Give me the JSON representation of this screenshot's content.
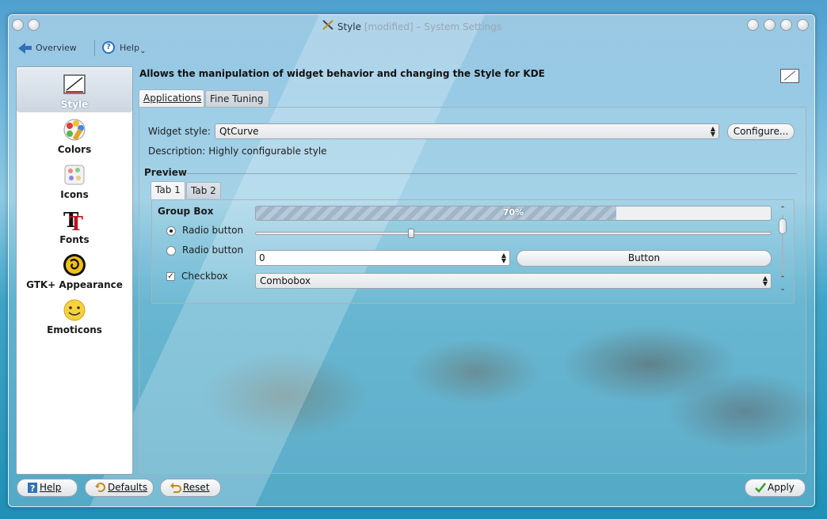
{
  "window": {
    "title_main": "Style",
    "title_modified": "[modified]",
    "title_sep": "–",
    "title_app": "System Settings"
  },
  "navbar": {
    "overview": "Overview",
    "help": "Help",
    "help_arrow": "⌄"
  },
  "sidebar": {
    "items": [
      {
        "label": "Style",
        "icon": "style-icon",
        "selected": true
      },
      {
        "label": "Colors",
        "icon": "colors-icon"
      },
      {
        "label": "Icons",
        "icon": "icons-icon"
      },
      {
        "label": "Fonts",
        "icon": "fonts-icon"
      },
      {
        "label": "GTK+ Appearance",
        "icon": "gtk-icon"
      },
      {
        "label": "Emoticons",
        "icon": "emoticons-icon"
      }
    ]
  },
  "main": {
    "description": "Allows the manipulation of widget behavior and changing the Style for KDE",
    "tabs": [
      {
        "label": "Applications",
        "active": true
      },
      {
        "label": "Fine Tuning",
        "active": false
      }
    ],
    "widget_style_label": "Widget style:",
    "widget_style_value": "QtCurve",
    "configure_label": "Configure...",
    "description_text": "Description: Highly configurable style",
    "preview_title": "Preview",
    "preview": {
      "tabs": [
        "Tab 1",
        "Tab 2"
      ],
      "group_box": "Group Box",
      "progress_percent": 70,
      "progress_text": "70%",
      "slider_fraction": 0.3,
      "radio1": "Radio button",
      "radio2": "Radio button",
      "spin_value": "0",
      "button_label": "Button",
      "checkbox_label": "Checkbox",
      "checkbox_checked": true,
      "combobox_value": "Combobox"
    }
  },
  "bottom": {
    "help": "Help",
    "defaults": "Defaults",
    "reset": "Reset",
    "apply": "Apply"
  },
  "colors": {
    "accent": "#2f72b8",
    "apply_check": "#3a9a2a"
  }
}
